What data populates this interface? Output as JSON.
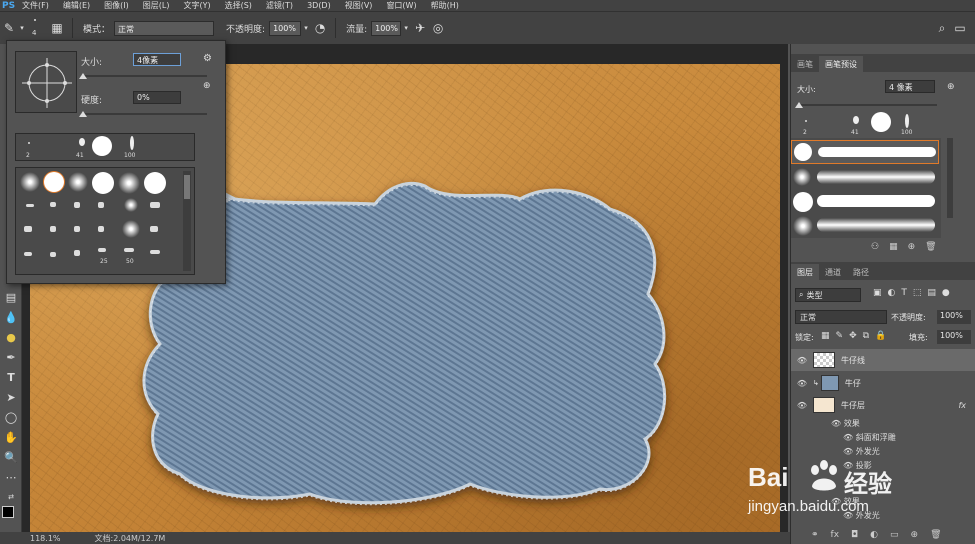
{
  "app": {
    "logo": "PS"
  },
  "menu": [
    "文件(F)",
    "编辑(E)",
    "图像(I)",
    "图层(L)",
    "文字(Y)",
    "选择(S)",
    "滤镜(T)",
    "3D(D)",
    "视图(V)",
    "窗口(W)",
    "帮助(H)"
  ],
  "options": {
    "brush_size": "4",
    "mode_label": "模式：",
    "mode_value": "正常",
    "opacity_label": "不透明度:",
    "opacity_value": "100%",
    "flow_label": "流量:",
    "flow_value": "100%"
  },
  "brush_picker": {
    "size_label": "大小:",
    "size_value": "4像素",
    "hardness_label": "硬度:",
    "hardness_value": "0%",
    "size_fraction": 0.02,
    "hardness_fraction": 0.0,
    "recent": [
      "2",
      "41",
      "100"
    ],
    "grid_labels": [
      "25",
      "50"
    ]
  },
  "status": {
    "zoom": "118.1%",
    "doc": "文档:2.04M/12.7M"
  },
  "right": {
    "tabs": [
      "画笔",
      "画笔预设"
    ],
    "preset_size_label": "大小:",
    "preset_size_value": "4 像素",
    "preset_recent": [
      "2",
      "41",
      "100"
    ],
    "layers_tabs": [
      "图层",
      "通道",
      "路径"
    ],
    "filter_label": "类型",
    "blend": "正常",
    "opacity_label": "不透明度:",
    "opacity": "100%",
    "lock_label": "锁定:",
    "fill_label": "填充:",
    "fill": "100%",
    "layers": [
      {
        "name": "牛仔线"
      },
      {
        "name": "牛仔"
      },
      {
        "name": "牛仔层"
      }
    ],
    "fx_label": "fx",
    "effects_header": "效果",
    "effects": [
      "斜面和浮雕",
      "外发光",
      "投影"
    ],
    "second_effects_header": "效果",
    "second_effects": [
      "外发光"
    ]
  },
  "watermark": {
    "brand": "Bai",
    "brand2": "经验",
    "url": "jingyan.baidu.com"
  }
}
